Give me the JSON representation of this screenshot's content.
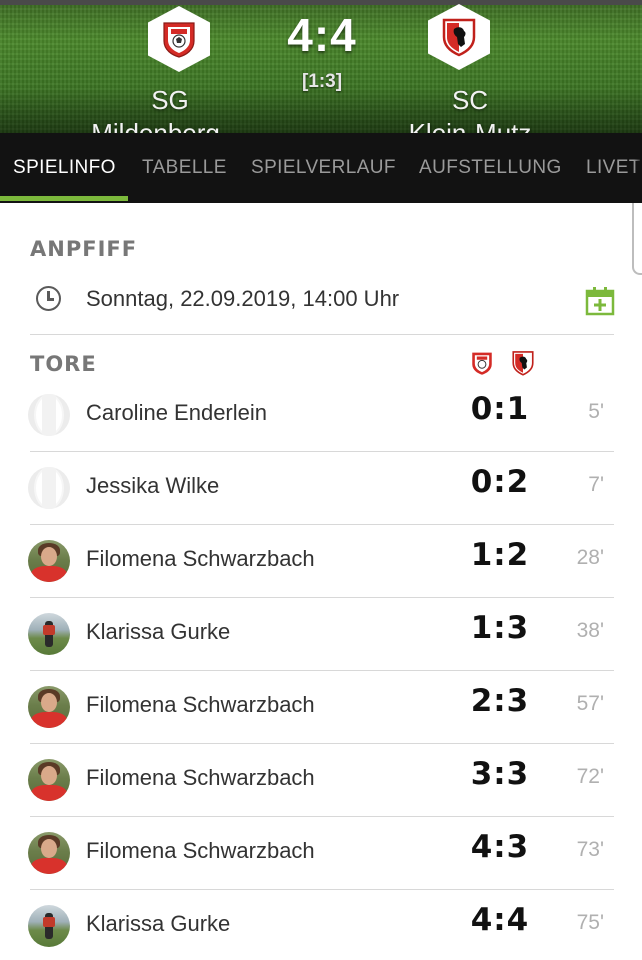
{
  "match": {
    "score": "4:4",
    "halftime": "[1:3]",
    "home_team": {
      "line1": "SG",
      "line2": "Mildenberg ..."
    },
    "away_team": {
      "line1": "SC",
      "line2": "Klein-Mutz"
    }
  },
  "tabs": [
    {
      "label": "SPIELINFO",
      "active": true
    },
    {
      "label": "TABELLE",
      "active": false
    },
    {
      "label": "SPIELVERLAUF",
      "active": false
    },
    {
      "label": "AUFSTELLUNG",
      "active": false
    },
    {
      "label": "LIVET",
      "active": false
    }
  ],
  "kickoff": {
    "title": "ANPFIFF",
    "datetime": "Sonntag, 22.09.2019, 14:00 Uhr",
    "icons": {
      "clock": "clock-icon",
      "calendar": "calendar-add-icon"
    }
  },
  "goals": {
    "title": "TORE",
    "list": [
      {
        "player": "Caroline Enderlein",
        "score": "0:1",
        "minute": "5'",
        "avatar": "placeholder"
      },
      {
        "player": "Jessika Wilke",
        "score": "0:2",
        "minute": "7'",
        "avatar": "placeholder"
      },
      {
        "player": "Filomena Schwarzbach",
        "score": "1:2",
        "minute": "28'",
        "avatar": "photo"
      },
      {
        "player": "Klarissa Gurke",
        "score": "1:3",
        "minute": "38'",
        "avatar": "photo"
      },
      {
        "player": "Filomena Schwarzbach",
        "score": "2:3",
        "minute": "57'",
        "avatar": "photo"
      },
      {
        "player": "Filomena Schwarzbach",
        "score": "3:3",
        "minute": "72'",
        "avatar": "photo"
      },
      {
        "player": "Filomena Schwarzbach",
        "score": "4:3",
        "minute": "73'",
        "avatar": "photo"
      },
      {
        "player": "Klarissa Gurke",
        "score": "4:4",
        "minute": "75'",
        "avatar": "photo"
      }
    ]
  },
  "colors": {
    "accent": "#7cb93c",
    "tab_bar": "#121212",
    "crest_red": "#d42b26"
  }
}
